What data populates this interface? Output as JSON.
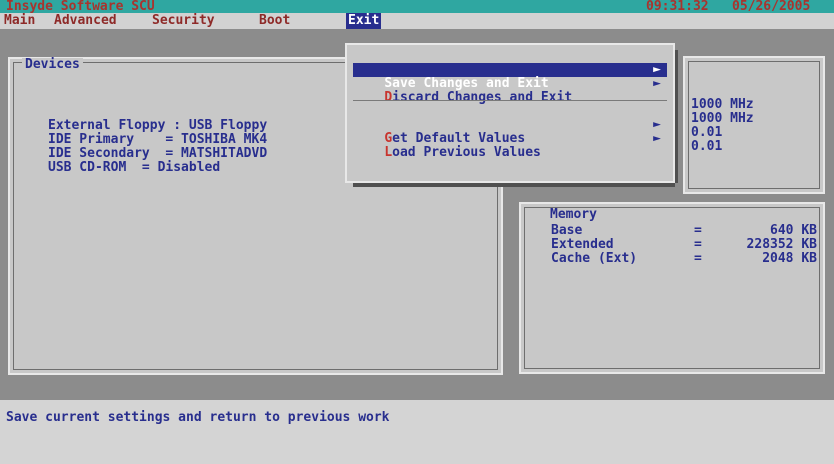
{
  "title_bar": {
    "app_title": "Insyde Software SCU",
    "time": "09:31:32",
    "date": "05/26/2005"
  },
  "menu": {
    "items": [
      {
        "label": "Main"
      },
      {
        "label": "Advanced"
      },
      {
        "label": "Security"
      },
      {
        "label": "Boot"
      },
      {
        "label": "Exit"
      }
    ]
  },
  "devices_panel": {
    "title": "Devices",
    "lines": [
      "External Floppy : USB Floppy",
      "IDE Primary    = TOSHIBA MK4",
      "IDE Secondary  = MATSHITADVD",
      "USB CD-ROM  = Disabled"
    ]
  },
  "cpu_panel": {
    "values": [
      "1000 MHz",
      "1000 MHz",
      "0.01",
      "0.01"
    ]
  },
  "memory_panel": {
    "title": "Memory",
    "rows": [
      {
        "label": "Base",
        "sep": "=",
        "value": "640 KB"
      },
      {
        "label": "Extended",
        "sep": "=",
        "value": "228352 KB"
      },
      {
        "label": "Cache (Ext)",
        "sep": "=",
        "value": "2048 KB"
      }
    ]
  },
  "exit_menu": {
    "items": [
      {
        "hotkey": "S",
        "rest": "ave Changes and Exit",
        "arrow": "►"
      },
      {
        "hotkey": "D",
        "rest": "iscard Changes and Exit",
        "arrow": "►"
      },
      {
        "hotkey": "G",
        "rest": "et Default Values",
        "arrow": "►"
      },
      {
        "hotkey": "L",
        "rest": "oad Previous Values",
        "arrow": "►"
      }
    ]
  },
  "status_bar": {
    "text": "Save current settings and return to previous work"
  },
  "colors": {
    "title_bg": "#2fa7a1",
    "menu_selected_bg": "#282e8e",
    "text_blue": "#282e8e",
    "hotkey_red": "#c8342e"
  }
}
